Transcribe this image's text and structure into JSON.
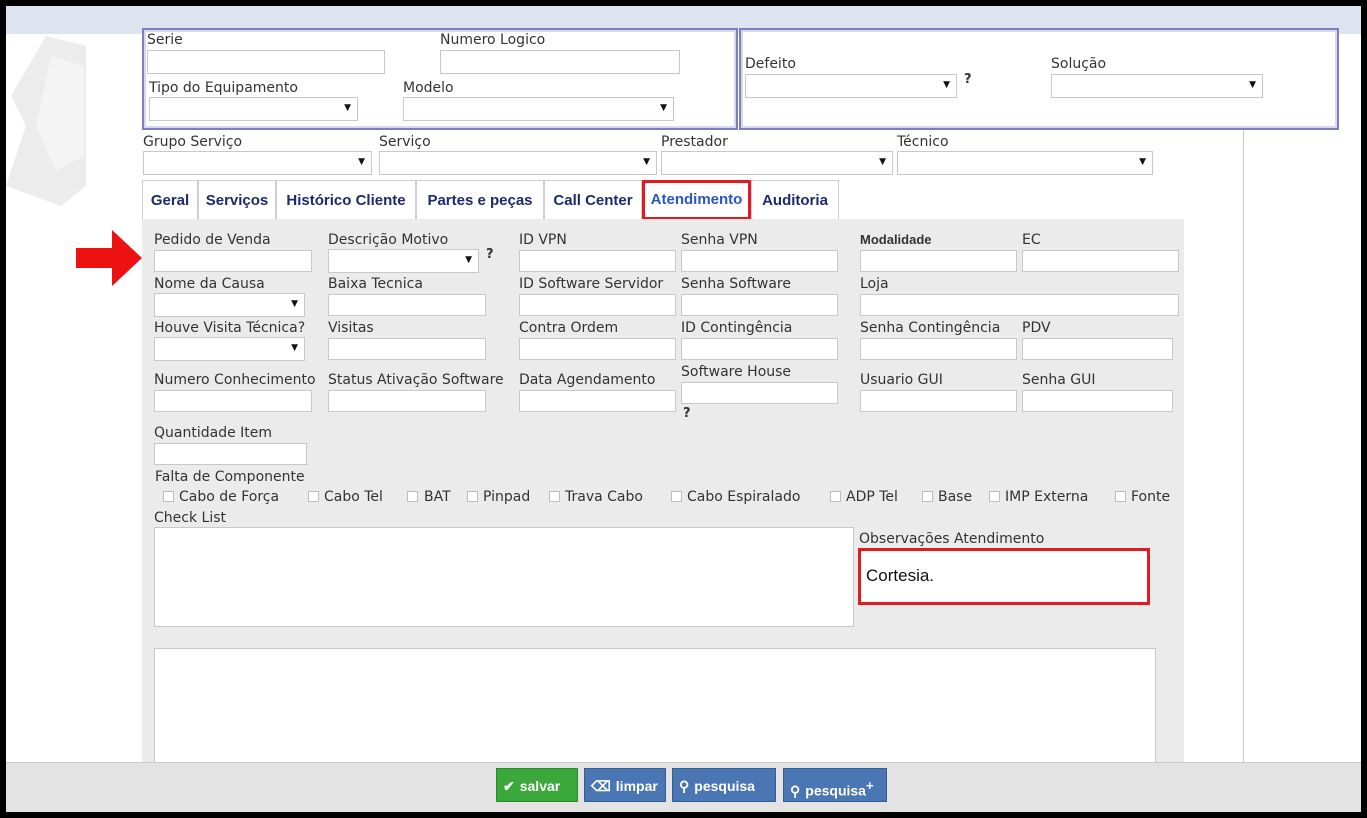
{
  "equipment": {
    "serie_label": "Serie",
    "numero_logico_label": "Numero Logico",
    "tipo_label": "Tipo do Equipamento",
    "modelo_label": "Modelo"
  },
  "defect": {
    "defeito_label": "Defeito",
    "solucao_label": "Solução",
    "help": "?"
  },
  "service_row": {
    "grupo_label": "Grupo Serviço",
    "servico_label": "Serviço",
    "prestador_label": "Prestador",
    "tecnico_label": "Técnico"
  },
  "tabs": [
    {
      "label": "Geral"
    },
    {
      "label": "Serviços"
    },
    {
      "label": "Histórico Cliente"
    },
    {
      "label": "Partes e peças"
    },
    {
      "label": "Call Center"
    },
    {
      "label": "Atendimento"
    },
    {
      "label": "Auditoria"
    }
  ],
  "form": {
    "pedido_venda": "Pedido de Venda",
    "descricao_motivo": "Descrição Motivo",
    "id_vpn": "ID VPN",
    "senha_vpn": "Senha VPN",
    "modalidade": "Modalidade",
    "ec": "EC",
    "nome_causa": "Nome da Causa",
    "baixa_tecnica": "Baixa Tecnica",
    "id_software_servidor": "ID Software Servidor",
    "senha_software": "Senha Software",
    "loja": "Loja",
    "houve_visita": "Houve Visita Técnica?",
    "visitas": "Visitas",
    "contra_ordem": "Contra Ordem",
    "id_contingencia": "ID Contingência",
    "senha_contingencia": "Senha Contingência",
    "pdv": "PDV",
    "numero_conhecimento": "Numero Conhecimento",
    "status_ativacao": "Status Ativação Software",
    "data_agendamento": "Data Agendamento",
    "software_house": "Software House",
    "usuario_gui": "Usuario GUI",
    "senha_gui": "Senha GUI",
    "quantidade_item": "Quantidade Item",
    "falta_componente": "Falta de Componente",
    "check_list": "Check List",
    "observacoes": "Observações Atendimento",
    "observacoes_value": "Cortesia.",
    "help": "?"
  },
  "components": [
    {
      "label": "Cabo de Força"
    },
    {
      "label": "Cabo Tel"
    },
    {
      "label": "BAT"
    },
    {
      "label": "Pinpad"
    },
    {
      "label": "Trava Cabo"
    },
    {
      "label": "Cabo Espiralado"
    },
    {
      "label": "ADP Tel"
    },
    {
      "label": "Base"
    },
    {
      "label": "IMP Externa"
    },
    {
      "label": "Fonte"
    }
  ],
  "footer": {
    "salvar": "salvar",
    "limpar": "limpar",
    "pesquisa": "pesquisa",
    "pesquisa_plus": "pesquisa",
    "plus": "+"
  },
  "colors": {
    "highlight": "#e01b24",
    "save_button": "#3aa83a",
    "blue_button": "#4a76b4",
    "tab_text": "#1c2a6e"
  }
}
